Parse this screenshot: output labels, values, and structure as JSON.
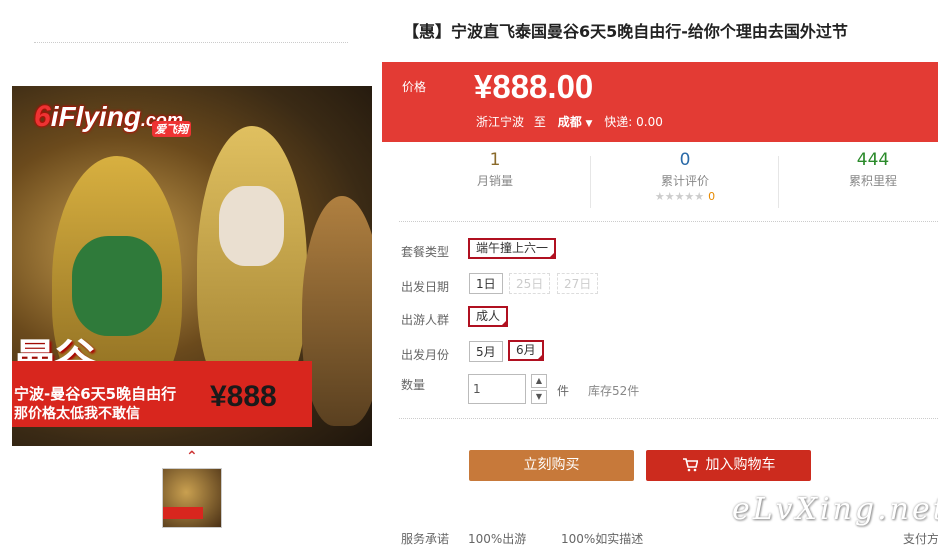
{
  "product": {
    "title": "【惠】宁波直飞泰国曼谷6天5晚自由行-给你个理由去国外过节"
  },
  "image": {
    "logo_text": "iFlying",
    "logo_domain": ".com",
    "logo_sub": "爱飞翔",
    "city": "曼谷",
    "banner_line1": "宁波-曼谷6天5晚自由行",
    "banner_line2": "那价格太低我不敢信",
    "banner_price": "¥888"
  },
  "pricing": {
    "label": "价格",
    "value": "¥888.00",
    "origin": "浙江宁波",
    "to": "至",
    "destination": "成都",
    "shipping": "快递: 0.00"
  },
  "stats": [
    {
      "value": "1",
      "label": "月销量",
      "color": "#8a6a2a"
    },
    {
      "value": "0",
      "label": "累计评价",
      "color": "#2a6aa8",
      "stars": "★★★★★",
      "star_count": "0"
    },
    {
      "value": "444",
      "label": "累积里程",
      "color": "#2a8a2a"
    }
  ],
  "options": {
    "package": {
      "label": "套餐类型",
      "values": [
        "端午撞上六一"
      ]
    },
    "date": {
      "label": "出发日期",
      "values": [
        "1日",
        "25日",
        "27日"
      ]
    },
    "crowd": {
      "label": "出游人群",
      "values": [
        "成人"
      ]
    },
    "month": {
      "label": "出发月份",
      "values": [
        "5月",
        "6月"
      ]
    }
  },
  "quantity": {
    "label": "数量",
    "value": "1",
    "unit": "件",
    "stock": "库存52件"
  },
  "buttons": {
    "buy": "立刻购买",
    "cart": "加入购物车"
  },
  "service": {
    "label": "服务承诺",
    "items": [
      "100%出游",
      "100%如实描述"
    ],
    "payment": "支付方"
  },
  "watermark": "eLvXing.net",
  "colors": {
    "accent_red": "#e33b34",
    "buy_button": "#c7793a",
    "cart_button": "#cc2b1e",
    "selected_border": "#b01020"
  }
}
